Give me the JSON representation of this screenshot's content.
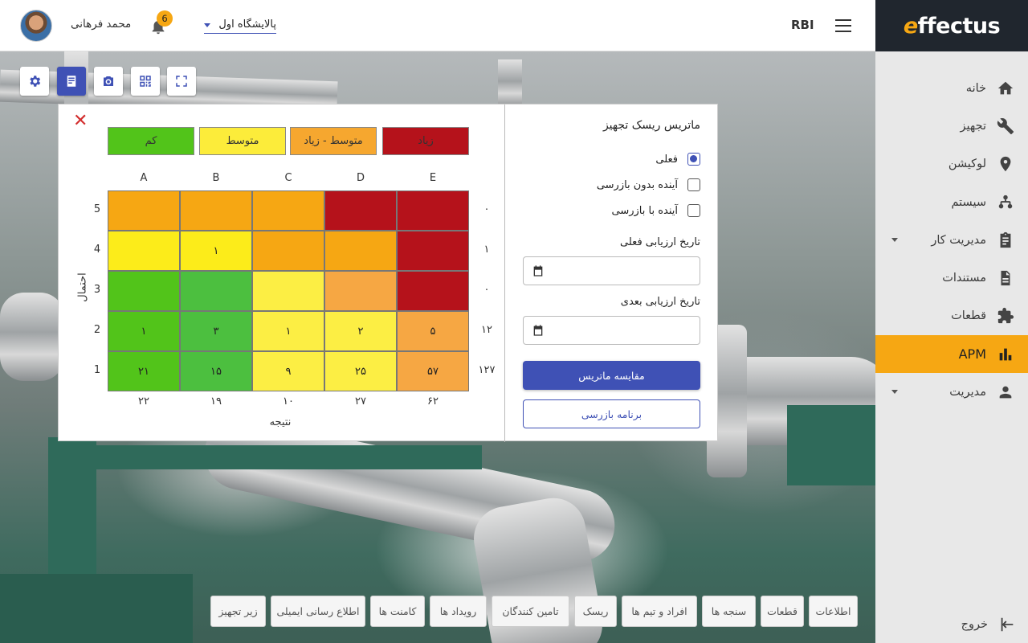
{
  "brand": {
    "logo_accent": "e",
    "logo_text": "ffectus"
  },
  "topbar": {
    "page_code": "RBI",
    "username": "محمد فرهانی",
    "notification_count": "6",
    "site_select_value": "پالایشگاه اول"
  },
  "sidebar": {
    "items": [
      {
        "label": "خانه",
        "icon": "home-icon"
      },
      {
        "label": "تجهیز",
        "icon": "wrench-icon"
      },
      {
        "label": "لوکیشن",
        "icon": "location-pin-icon"
      },
      {
        "label": "سیستم",
        "icon": "hierarchy-icon"
      },
      {
        "label": "مدیریت کار",
        "icon": "clipboard-icon",
        "has_submenu": true
      },
      {
        "label": "مستندات",
        "icon": "document-icon"
      },
      {
        "label": "قطعات",
        "icon": "puzzle-icon"
      },
      {
        "label": "APM",
        "icon": "bar-chart-icon",
        "active": true
      },
      {
        "label": "مدیریت",
        "icon": "person-icon",
        "has_submenu": true
      }
    ],
    "logout_label": "خروج"
  },
  "toolbar": [
    "settings-icon",
    "report-icon",
    "camera-icon",
    "qr-code-icon",
    "fullscreen-icon"
  ],
  "panel": {
    "title": "ماتریس ریسک تجهیز",
    "options": [
      {
        "label": "فعلی",
        "checked": true
      },
      {
        "label": "آینده بدون بازرسی",
        "checked": false
      },
      {
        "label": "آینده با بازرسی",
        "checked": false
      }
    ],
    "current_date_label": "تاریخ ارزیابی فعلی",
    "next_date_label": "تاریخ ارزیابی بعدی",
    "compare_button": "مقایسه ماتریس",
    "inspection_button": "برنامه بازرسی",
    "legend": [
      {
        "label": "زیاد",
        "color": "#b5121b"
      },
      {
        "label": "متوسط - زیاد",
        "color": "#f6a72f"
      },
      {
        "label": "متوسط",
        "color": "#fcec3a"
      },
      {
        "label": "کم",
        "color": "#52c41a"
      }
    ],
    "matrix": {
      "x_categories": [
        "A",
        "B",
        "C",
        "D",
        "E"
      ],
      "y_levels": [
        "5",
        "4",
        "3",
        "2",
        "1"
      ],
      "y_axis_label": "احتمال",
      "x_axis_label": "نتیجه",
      "row_totals": [
        "۰",
        "۱",
        "۰",
        "۱۲",
        "۱۲۷"
      ],
      "col_totals": [
        "۲۲",
        "۱۹",
        "۱۰",
        "۲۷",
        "۶۲"
      ],
      "cells": [
        [
          {
            "v": "",
            "c": "#f6a713"
          },
          {
            "v": "",
            "c": "#f6a713"
          },
          {
            "v": "",
            "c": "#f6a713"
          },
          {
            "v": "",
            "c": "#b5121b"
          },
          {
            "v": "",
            "c": "#b5121b"
          }
        ],
        [
          {
            "v": "",
            "c": "#fcec1a"
          },
          {
            "v": "۱",
            "c": "#fcec1a"
          },
          {
            "v": "",
            "c": "#f6a713"
          },
          {
            "v": "",
            "c": "#f6a713"
          },
          {
            "v": "",
            "c": "#b5121b"
          }
        ],
        [
          {
            "v": "",
            "c": "#52c41a"
          },
          {
            "v": "",
            "c": "#4cbf3f"
          },
          {
            "v": "",
            "c": "#fcee44"
          },
          {
            "v": "",
            "c": "#f6a743"
          },
          {
            "v": "",
            "c": "#b5121b"
          }
        ],
        [
          {
            "v": "۱",
            "c": "#52c41a"
          },
          {
            "v": "۳",
            "c": "#4cbf3f"
          },
          {
            "v": "۱",
            "c": "#fcee44"
          },
          {
            "v": "۲",
            "c": "#fcee44"
          },
          {
            "v": "۵",
            "c": "#f6a743"
          }
        ],
        [
          {
            "v": "۲۱",
            "c": "#52c41a"
          },
          {
            "v": "۱۵",
            "c": "#4cbf3f"
          },
          {
            "v": "۹",
            "c": "#fcee44"
          },
          {
            "v": "۲۵",
            "c": "#fcee44"
          },
          {
            "v": "۵۷",
            "c": "#f6a743"
          }
        ]
      ]
    }
  },
  "bottom_tabs": [
    "اطلاعات",
    "قطعات",
    "سنجه ها",
    "افراد و تیم ها",
    "ریسک",
    "تامین کنندگان",
    "رویداد ها",
    "کامنت ها",
    "اطلاع رسانی ایمیلی",
    "زیر تجهیز"
  ]
}
